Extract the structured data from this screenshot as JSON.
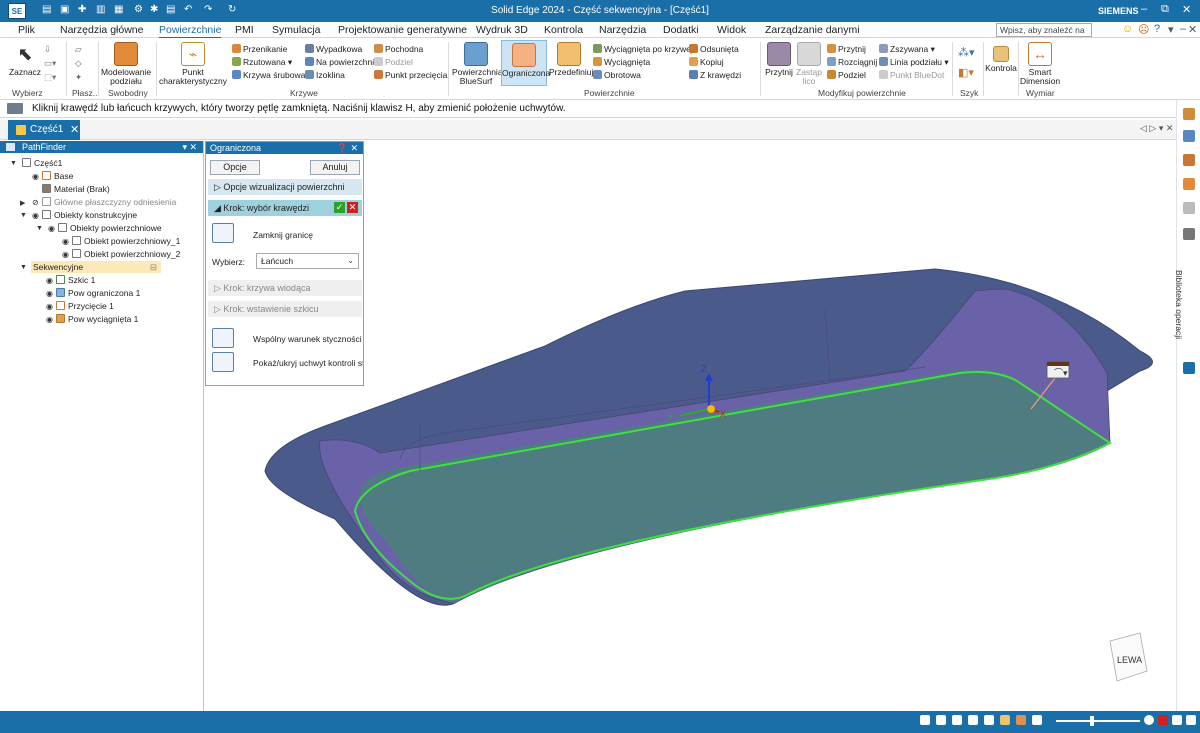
{
  "app": {
    "logo": "SE",
    "title": "Solid Edge 2024 - Część sekwencyjna - [Część1]",
    "brand": "SIEMENS"
  },
  "quick_access": [
    "new-icon",
    "save-icon",
    "pin-icon",
    "save-all-icon",
    "print-icon",
    "settings-icon",
    "customize-icon",
    "undo-icon",
    "redo-icon",
    "view-icon"
  ],
  "window_controls": {
    "minimize": "–",
    "restore": "⧉",
    "close": "✕"
  },
  "menu": {
    "tabs": [
      "Plik",
      "Narzędzia główne",
      "Powierzchnie",
      "PMI",
      "Symulacja",
      "Projektowanie generatywne",
      "Wydruk 3D",
      "Kontrola",
      "Narzędzia",
      "Dodatki",
      "Widok",
      "Zarządzanie danymi"
    ],
    "active_tab": "Powierzchnie",
    "search_placeholder": "Wpisz, aby znaleźć na"
  },
  "ribbon": {
    "wybierz": {
      "label": "Wybierz",
      "zaznacz": "Zaznacz"
    },
    "plaszcz": {
      "label": "Płasz..."
    },
    "swobodny": {
      "label": "Swobodny",
      "modelowanie": "Modelowanie podziału"
    },
    "krzywe": {
      "label": "Krzywe",
      "punkt": "Punkt charakterystyczny",
      "items": [
        "Przenikanie",
        "Rzutowana",
        "Krzywa śrubowa",
        "Wypadkowa",
        "Na powierzchni",
        "Izoklina",
        "Pochodna",
        "Podziel",
        "Punkt przecięcia"
      ]
    },
    "powierzchnie": {
      "label": "Powierzchnie",
      "bluesurf": "Powierzchnia BlueSurf",
      "ograniczona": "Ograniczona",
      "przedefiniuj": "Przedefiniuj",
      "items": [
        "Wyciągnięta po krzywej",
        "Wyciągnięta",
        "Obrotowa",
        "Odsunięta",
        "Kopiuj",
        "Z krawędzi"
      ]
    },
    "modyfikuj": {
      "label": "Modyfikuj powierzchnie",
      "przytnij_big": "Przytnij",
      "zastap": "Zastąp lico",
      "items": [
        "Przytnij",
        "Rozciągnij",
        "Podziel",
        "Zszywana",
        "Linia podziału",
        "Punkt BlueDot"
      ]
    },
    "szyk": {
      "label": "Szyk"
    },
    "kontrola": {
      "label": "Kontrola"
    },
    "wymiar": {
      "label": "Wymiar",
      "smart": "Smart Dimension"
    }
  },
  "prompt": "Kliknij krawędź lub łańcuch krzywych, który tworzy pętlę zamkniętą. Naciśnij klawisz H, aby zmienić położenie uchwytów.",
  "doc_tab": {
    "label": "Część1",
    "close": "✕"
  },
  "pathfinder": {
    "title": "PathFinder",
    "items": [
      {
        "label": "Część1"
      },
      {
        "label": "Base"
      },
      {
        "label": "Materiał (Brak)"
      },
      {
        "label": "Główne płaszczyzny odniesienia"
      },
      {
        "label": "Obiekty konstrukcyjne"
      },
      {
        "label": "Obiekty powierzchniowe"
      },
      {
        "label": "Obiekt powierzchniowy_1"
      },
      {
        "label": "Obiekt powierzchniowy_2"
      },
      {
        "label": "Sekwencyjne"
      },
      {
        "label": "Szkic 1"
      },
      {
        "label": "Pow ograniczona 1"
      },
      {
        "label": "Przycięcie 1"
      },
      {
        "label": "Pow wyciągnięta 1"
      }
    ]
  },
  "ograniczona": {
    "title": "Ograniczona",
    "opcje": "Opcje",
    "anuluj": "Anuluj",
    "viz": "Opcje wizualizacji powierzchni",
    "step_edge": "Krok: wybór krawędzi",
    "zamknij": "Zamknij granicę",
    "wybierz_label": "Wybierz:",
    "wybierz_value": "Łańcuch",
    "step_curve": "Krok: krzywa wiodąca",
    "step_sketch": "Krok: wstawienie szkicu",
    "warunek": "Wspólny warunek styczności",
    "pokaz": "Pokaż/ukryj uchwyt kontroli styc"
  },
  "viewport": {
    "axis_x": "X",
    "axis_y": "Y",
    "axis_z": "Z",
    "view_cube": "LEWA",
    "colors": {
      "outer_surface": "#4a5a8a",
      "inner_wall": "#6a62a8",
      "floor": "#4f7c80",
      "edge_highlight": "#3fe03f"
    }
  },
  "side_panel": {
    "label": "Biblioteka operacji"
  },
  "colors": {
    "accent": "#1a6fa8",
    "selected": "#fde8b8"
  }
}
